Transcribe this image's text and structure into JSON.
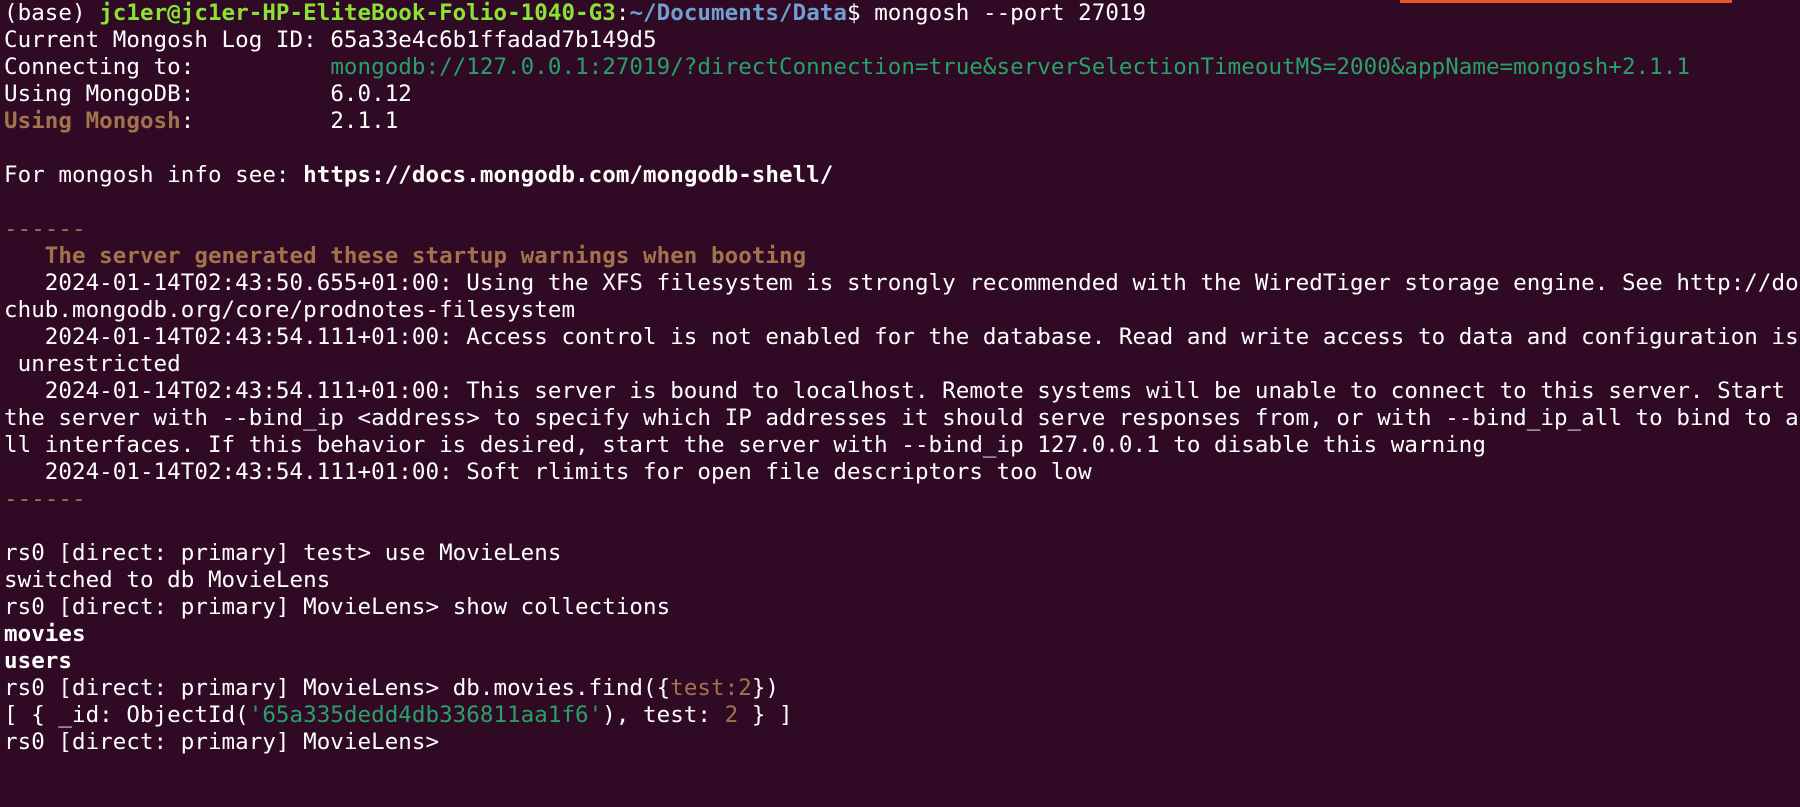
{
  "terminal": {
    "prompt": {
      "env": "(base) ",
      "user_host": "jc1er@jc1er-HP-EliteBook-Folio-1040-G3",
      "colon": ":",
      "path": "~/Documents/Data",
      "dollar": "$ ",
      "command": "mongosh --port 27019"
    },
    "log_id_line": "Current Mongosh Log ID:\t65a33e4c6b1ffadad7b149d5",
    "log_id_label": "Current Mongosh Log ID: ",
    "log_id_value": "65a33e4c6b1ffadad7b149d5",
    "connecting_label": "Connecting to:          ",
    "connecting_url": "mongodb://127.0.0.1:27019/?directConnection=true&serverSelectionTimeoutMS=2000&appName=mongosh+2.1.1",
    "mongodb_label": "Using MongoDB:          ",
    "mongodb_version": "6.0.12",
    "mongosh_label": "Using Mongosh",
    "mongosh_pad": ":          ",
    "mongosh_version": "2.1.1",
    "info_prefix": "For mongosh info see: ",
    "info_url": "https://docs.mongodb.com/mongodb-shell/",
    "separator": "------",
    "warnings_header": "   The server generated these startup warnings when booting",
    "warnings": [
      "   2024-01-14T02:43:50.655+01:00: Using the XFS filesystem is strongly recommended with the WiredTiger storage engine. See http://do",
      "chub.mongodb.org/core/prodnotes-filesystem",
      "   2024-01-14T02:43:54.111+01:00: Access control is not enabled for the database. Read and write access to data and configuration is",
      " unrestricted",
      "   2024-01-14T02:43:54.111+01:00: This server is bound to localhost. Remote systems will be unable to connect to this server. Start",
      "the server with --bind_ip <address> to specify which IP addresses it should serve responses from, or with --bind_ip_all to bind to a",
      "ll interfaces. If this behavior is desired, start the server with --bind_ip 127.0.0.1 to disable this warning",
      "   2024-01-14T02:43:54.111+01:00: Soft rlimits for open file descriptors too low"
    ],
    "session": {
      "prompt_test": "rs0 [direct: primary] test> ",
      "cmd_use": "use MovieLens",
      "switched": "switched to db MovieLens",
      "prompt_movielens": "rs0 [direct: primary] MovieLens> ",
      "cmd_show": "show collections",
      "collections": [
        "movies",
        "users"
      ],
      "cmd_find_prefix": "db.movies.find({",
      "cmd_find_key": "test:",
      "cmd_find_num": "2",
      "cmd_find_suffix": "})",
      "result_prefix": "[ { _id: ObjectId(",
      "result_oid": "'65a335dedd4db336811aa1f6'",
      "result_mid": "), test: ",
      "result_num": "2",
      "result_suffix": " } ]"
    }
  },
  "colors": {
    "background": "#300a24",
    "prompt_user": "#8ae234",
    "prompt_path": "#729fcf",
    "green": "#26a269",
    "tan": "#a2734c",
    "accent": "#e95420"
  }
}
